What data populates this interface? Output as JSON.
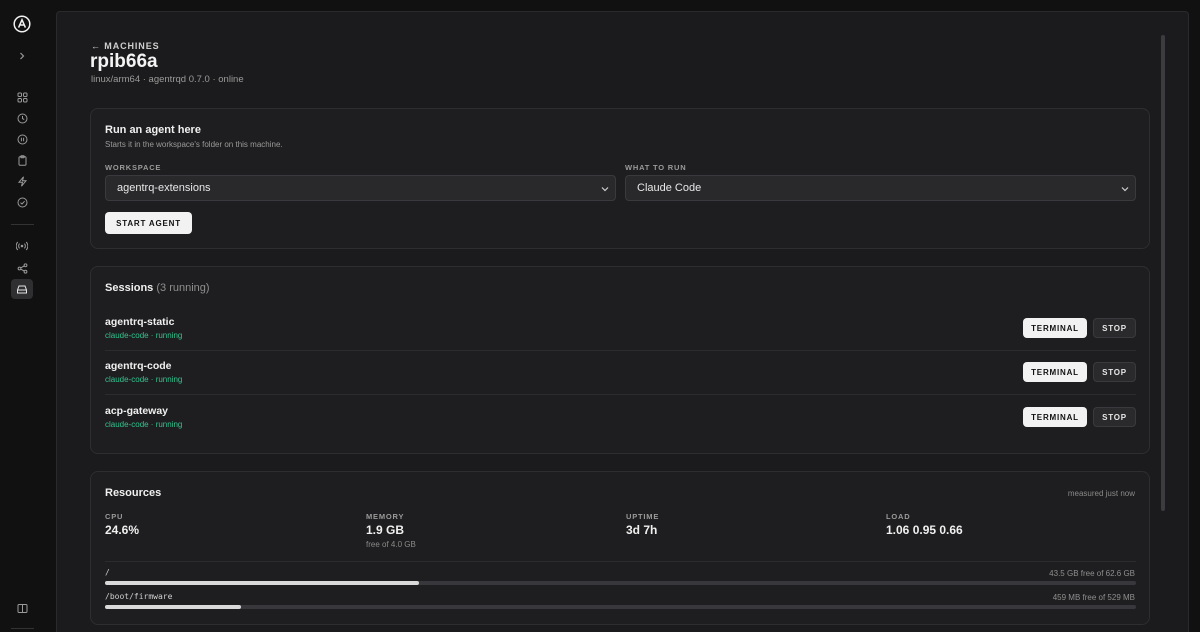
{
  "header": {
    "back_label": "← MACHINES",
    "title": "rpib66a",
    "subtitle": "linux/arm64 · agentrqd 0.7.0 · online"
  },
  "run_agent": {
    "title": "Run an agent here",
    "description": "Starts it in the workspace's folder on this machine.",
    "workspace_label": "WORKSPACE",
    "workspace_value": "agentrq-extensions",
    "run_label": "WHAT TO RUN",
    "run_value": "Claude Code",
    "start_button": "START AGENT"
  },
  "sessions": {
    "title": "Sessions",
    "count_label": "(3 running)",
    "terminal_label": "TERMINAL",
    "stop_label": "STOP",
    "items": [
      {
        "name": "agentrq-static",
        "meta": "claude-code · running"
      },
      {
        "name": "agentrq-code",
        "meta": "claude-code · running"
      },
      {
        "name": "acp-gateway",
        "meta": "claude-code · running"
      }
    ]
  },
  "resources": {
    "title": "Resources",
    "measured": "measured just now",
    "cpu": {
      "label": "CPU",
      "value": "24.6%"
    },
    "memory": {
      "label": "MEMORY",
      "value": "1.9 GB",
      "sub": "free of 4.0 GB"
    },
    "uptime": {
      "label": "UPTIME",
      "value": "3d 7h"
    },
    "load": {
      "label": "LOAD",
      "value": "1.06 0.95 0.66"
    },
    "disks": [
      {
        "mount": "/",
        "free": "43.5 GB free of 62.6 GB",
        "used_fraction": 0.305
      },
      {
        "mount": "/boot/firmware",
        "free": "459 MB free of 529 MB",
        "used_fraction": 0.132
      }
    ]
  },
  "colors": {
    "accent_running": "#34c38f",
    "background": "#1b1b1d"
  },
  "icons": [
    "logo-icon",
    "expand-icon",
    "grid-icon",
    "clock-icon",
    "pause-icon",
    "clipboard-icon",
    "bolt-icon",
    "check-circle-icon",
    "broadcast-icon",
    "share-icon",
    "machine-icon",
    "book-icon"
  ]
}
